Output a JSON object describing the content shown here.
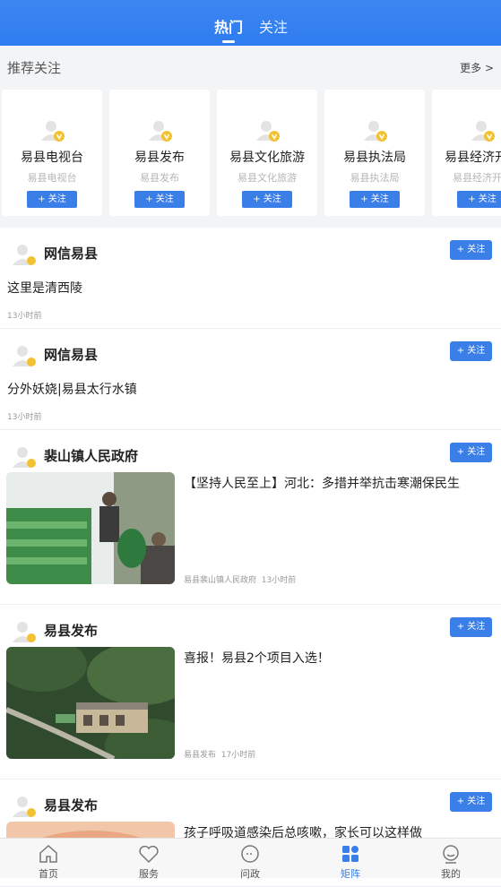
{
  "header": {
    "tabs": [
      {
        "label": "热门",
        "active": true
      },
      {
        "label": "关注",
        "active": false
      }
    ]
  },
  "recommend": {
    "title": "推荐关注",
    "more": "更多 >",
    "follow_label": "+ 关注",
    "cards": [
      {
        "name": "易县电视台",
        "sub": "易县电视台"
      },
      {
        "name": "易县发布",
        "sub": "易县发布"
      },
      {
        "name": "易县文化旅游",
        "sub": "易县文化旅游"
      },
      {
        "name": "易县执法局",
        "sub": "易县执法局"
      },
      {
        "name": "易县经济开发",
        "sub": "易县经济开发"
      }
    ]
  },
  "feed": {
    "follow_label": "+ 关注",
    "posts": [
      {
        "author": "网信易县",
        "text": "这里是清西陵",
        "time": "13小时前"
      },
      {
        "author": "网信易县",
        "text": "分外妖娆|易县太行水镇",
        "time": "13小时前"
      },
      {
        "author": "裴山镇人民政府",
        "title": "【坚持人民至上】河北：多措并举抗击寒潮保民生",
        "source": "易县裴山镇人民政府",
        "time": "13小时前"
      },
      {
        "author": "易县发布",
        "title": "喜报！易县2个项目入选！",
        "source": "易县发布",
        "time": "17小时前"
      },
      {
        "author": "易县发布",
        "title": "孩子呼吸道感染后总咳嗽，家长可以这样做"
      }
    ]
  },
  "tabbar": {
    "items": [
      {
        "label": "首页",
        "icon": "home-icon"
      },
      {
        "label": "服务",
        "icon": "heart-icon"
      },
      {
        "label": "问政",
        "icon": "chat-icon"
      },
      {
        "label": "矩阵",
        "icon": "grid-icon",
        "active": true
      },
      {
        "label": "我的",
        "icon": "user-face-icon"
      }
    ]
  },
  "colors": {
    "accent": "#3a7ee8",
    "header": "#2f7cf0",
    "verified": "#f2c232"
  }
}
